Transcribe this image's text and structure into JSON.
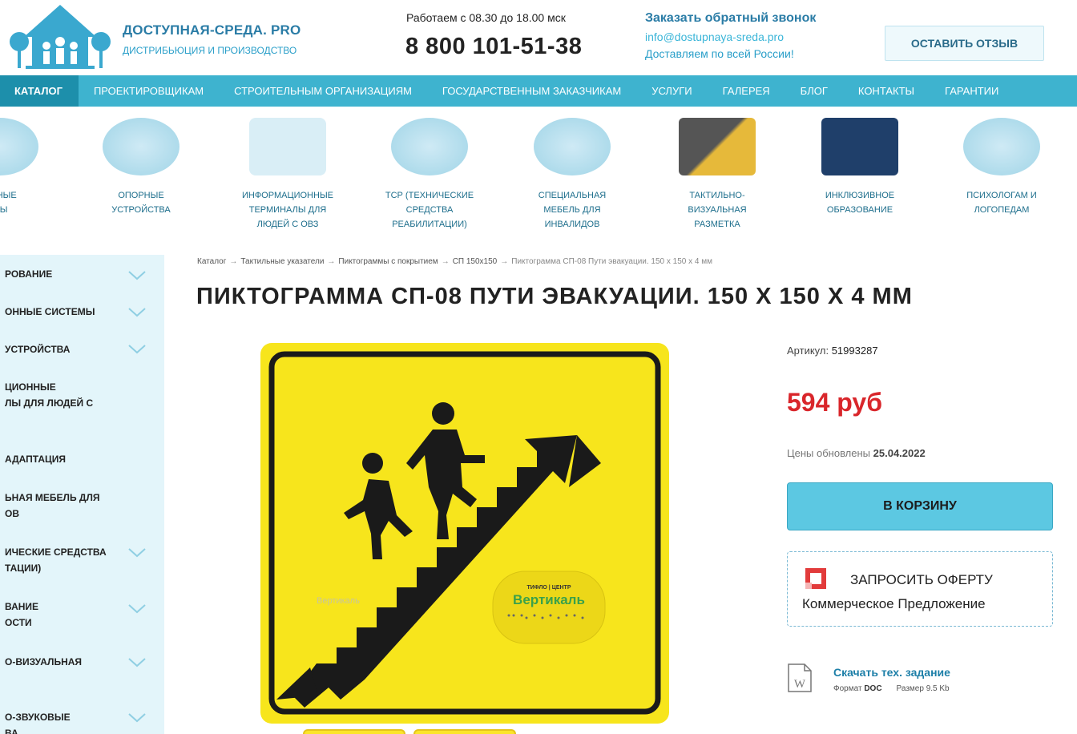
{
  "header": {
    "brand_title": "ДОСТУПНАЯ-СРЕДА. PRO",
    "brand_subtitle": "ДИСТРИБЬЮЦИЯ И ПРОИЗВОДСТВО",
    "hours": "Работаем с 08.30 до 18.00 мск",
    "phone": "8 800 101-51-38",
    "callback": "Заказать обратный звонок",
    "email": "info@dostupnaya-sreda.pro",
    "delivery": "Доставляем по всей России!",
    "review_button": "ОСТАВИТЬ ОТЗЫВ"
  },
  "nav": {
    "items": [
      "КАТАЛОГ",
      "ПРОЕКТИРОВЩИКАМ",
      "СТРОИТЕЛЬНЫМ ОРГАНИЗАЦИЯМ",
      "ГОСУДАРСТВЕННЫМ ЗАКАЗЧИКАМ",
      "УСЛУГИ",
      "ГАЛЕРЕЯ",
      "БЛОГ",
      "КОНТАКТЫ",
      "ГАРАНТИИ"
    ]
  },
  "categories": [
    "ОННЫЕ\nМЫ",
    "ОПОРНЫЕ\nУСТРОЙСТВА",
    "ИНФОРМАЦИОННЫЕ\nТЕРМИНАЛЫ ДЛЯ\nЛЮДЕЙ С ОВЗ",
    "ТСР (ТЕХНИЧЕСКИЕ\nСРЕДСТВА\nРЕАБИЛИТАЦИИ)",
    "СПЕЦИАЛЬНАЯ\nМЕБЕЛЬ ДЛЯ\nИНВАЛИДОВ",
    "ТАКТИЛЬНО-\nВИЗУАЛЬНАЯ\nРАЗМЕТКА",
    "ИНКЛЮЗИВНОЕ\nОБРАЗОВАНИЕ",
    "ПСИХОЛОГАМ И\nЛОГОПЕДАМ"
  ],
  "sidebar": {
    "items": [
      "РОВАНИЕ",
      "ОННЫЕ СИСТЕМЫ",
      "УСТРОЙСТВА",
      "ЦИОННЫЕ\nЛЫ ДЛЯ ЛЮДЕЙ С",
      "АДАПТАЦИЯ",
      "ЬНАЯ МЕБЕЛЬ ДЛЯ\nОВ",
      "ИЧЕСКИЕ СРЕДСТВА\nТАЦИИ)",
      "ВАНИЕ\nОСТИ",
      "О-ВИЗУАЛЬНАЯ",
      "О-ЗВУКОВЫЕ\nВА"
    ]
  },
  "breadcrumb": {
    "items": [
      "Каталог",
      "Тактильные указатели",
      "Пиктограммы с покрытием",
      "СП 150x150",
      "Пиктограмма СП-08 Пути эвакуации. 150 х 150 х 4 мм"
    ],
    "separator": "→"
  },
  "product": {
    "title": "ПИКТОГРАММА СП-08 ПУТИ ЭВАКУАЦИИ. 150 Х 150 Х 4 ММ",
    "sku_label": "Артикул:",
    "sku": "51993287",
    "price": "594 руб",
    "price_updated_label": "Цены обновлены",
    "price_updated_date": "25.04.2022",
    "cart_button": "В КОРЗИНУ",
    "offer_title": "ЗАПРОСИТЬ ОФЕРТУ",
    "offer_subtitle": "Коммерческое Предложение",
    "doc_link": "Скачать тех. задание",
    "doc_format_label": "Формат",
    "doc_format": "DOC",
    "doc_size": "Размер 9.5 Kb",
    "sign_brand_small": "ТИФЛО | ЦЕНТР",
    "sign_brand": "Вертикаль",
    "watermark": "Вертикаль"
  },
  "colors": {
    "nav_bg": "#3eb3cf",
    "nav_active": "#1d8fab",
    "price": "#d9262b",
    "cart_button": "#5cc8e2",
    "sign_yellow": "#f7e51c"
  }
}
